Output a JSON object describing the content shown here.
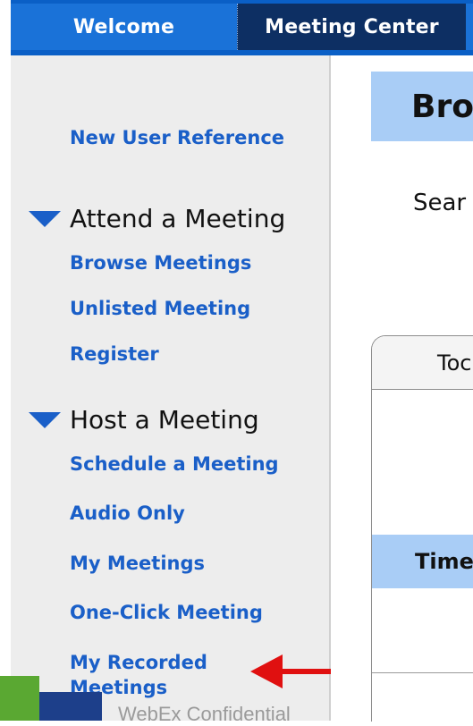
{
  "nav": {
    "tabs": [
      {
        "label": "Welcome"
      },
      {
        "label": "Meeting Center"
      }
    ]
  },
  "sidebar": {
    "top_link": "New User Reference",
    "sections": [
      {
        "title": "Attend a Meeting",
        "items": [
          "Browse Meetings",
          "Unlisted Meeting",
          "Register"
        ]
      },
      {
        "title": "Host a Meeting",
        "items": [
          "Schedule a Meeting",
          "Audio Only",
          "My Meetings",
          "One-Click Meeting",
          "My Recorded Meetings"
        ]
      }
    ]
  },
  "main": {
    "page_title_partial": "Bro",
    "search_label_partial": "Sear",
    "panel_tab_partial": "Toc",
    "panel_header_partial": "Time"
  },
  "footer": {
    "text": "WebEx Confidential"
  },
  "colors": {
    "nav_blue": "#0a5fc6",
    "active_tab": "#0d2f63",
    "link_blue": "#1a5fc8",
    "header_light_blue": "#a9cdf6",
    "annotation_arrow": "#e01010"
  }
}
